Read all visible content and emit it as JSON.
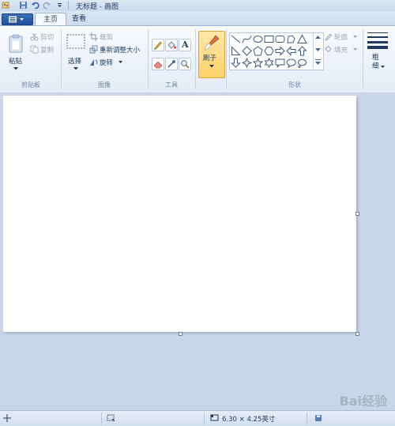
{
  "window": {
    "title": "无标题 - 画图"
  },
  "tabs": {
    "home": "主页",
    "view": "查看"
  },
  "clipboard": {
    "paste": "粘贴",
    "cut": "剪切",
    "copy": "复制",
    "group": "剪贴板"
  },
  "image": {
    "select": "选择",
    "crop": "裁剪",
    "resize": "重新调整大小",
    "rotate": "旋转",
    "group": "图像"
  },
  "tools": {
    "group": "工具",
    "text_glyph": "A"
  },
  "brushes": {
    "label": "刷子"
  },
  "shapes": {
    "outline": "轮廓",
    "fill": "填充",
    "group": "形状"
  },
  "size": {
    "label": "粗细"
  },
  "status": {
    "dimensions": "6.30 × 4.25英寸"
  },
  "watermark": {
    "text": "Bai经验"
  }
}
